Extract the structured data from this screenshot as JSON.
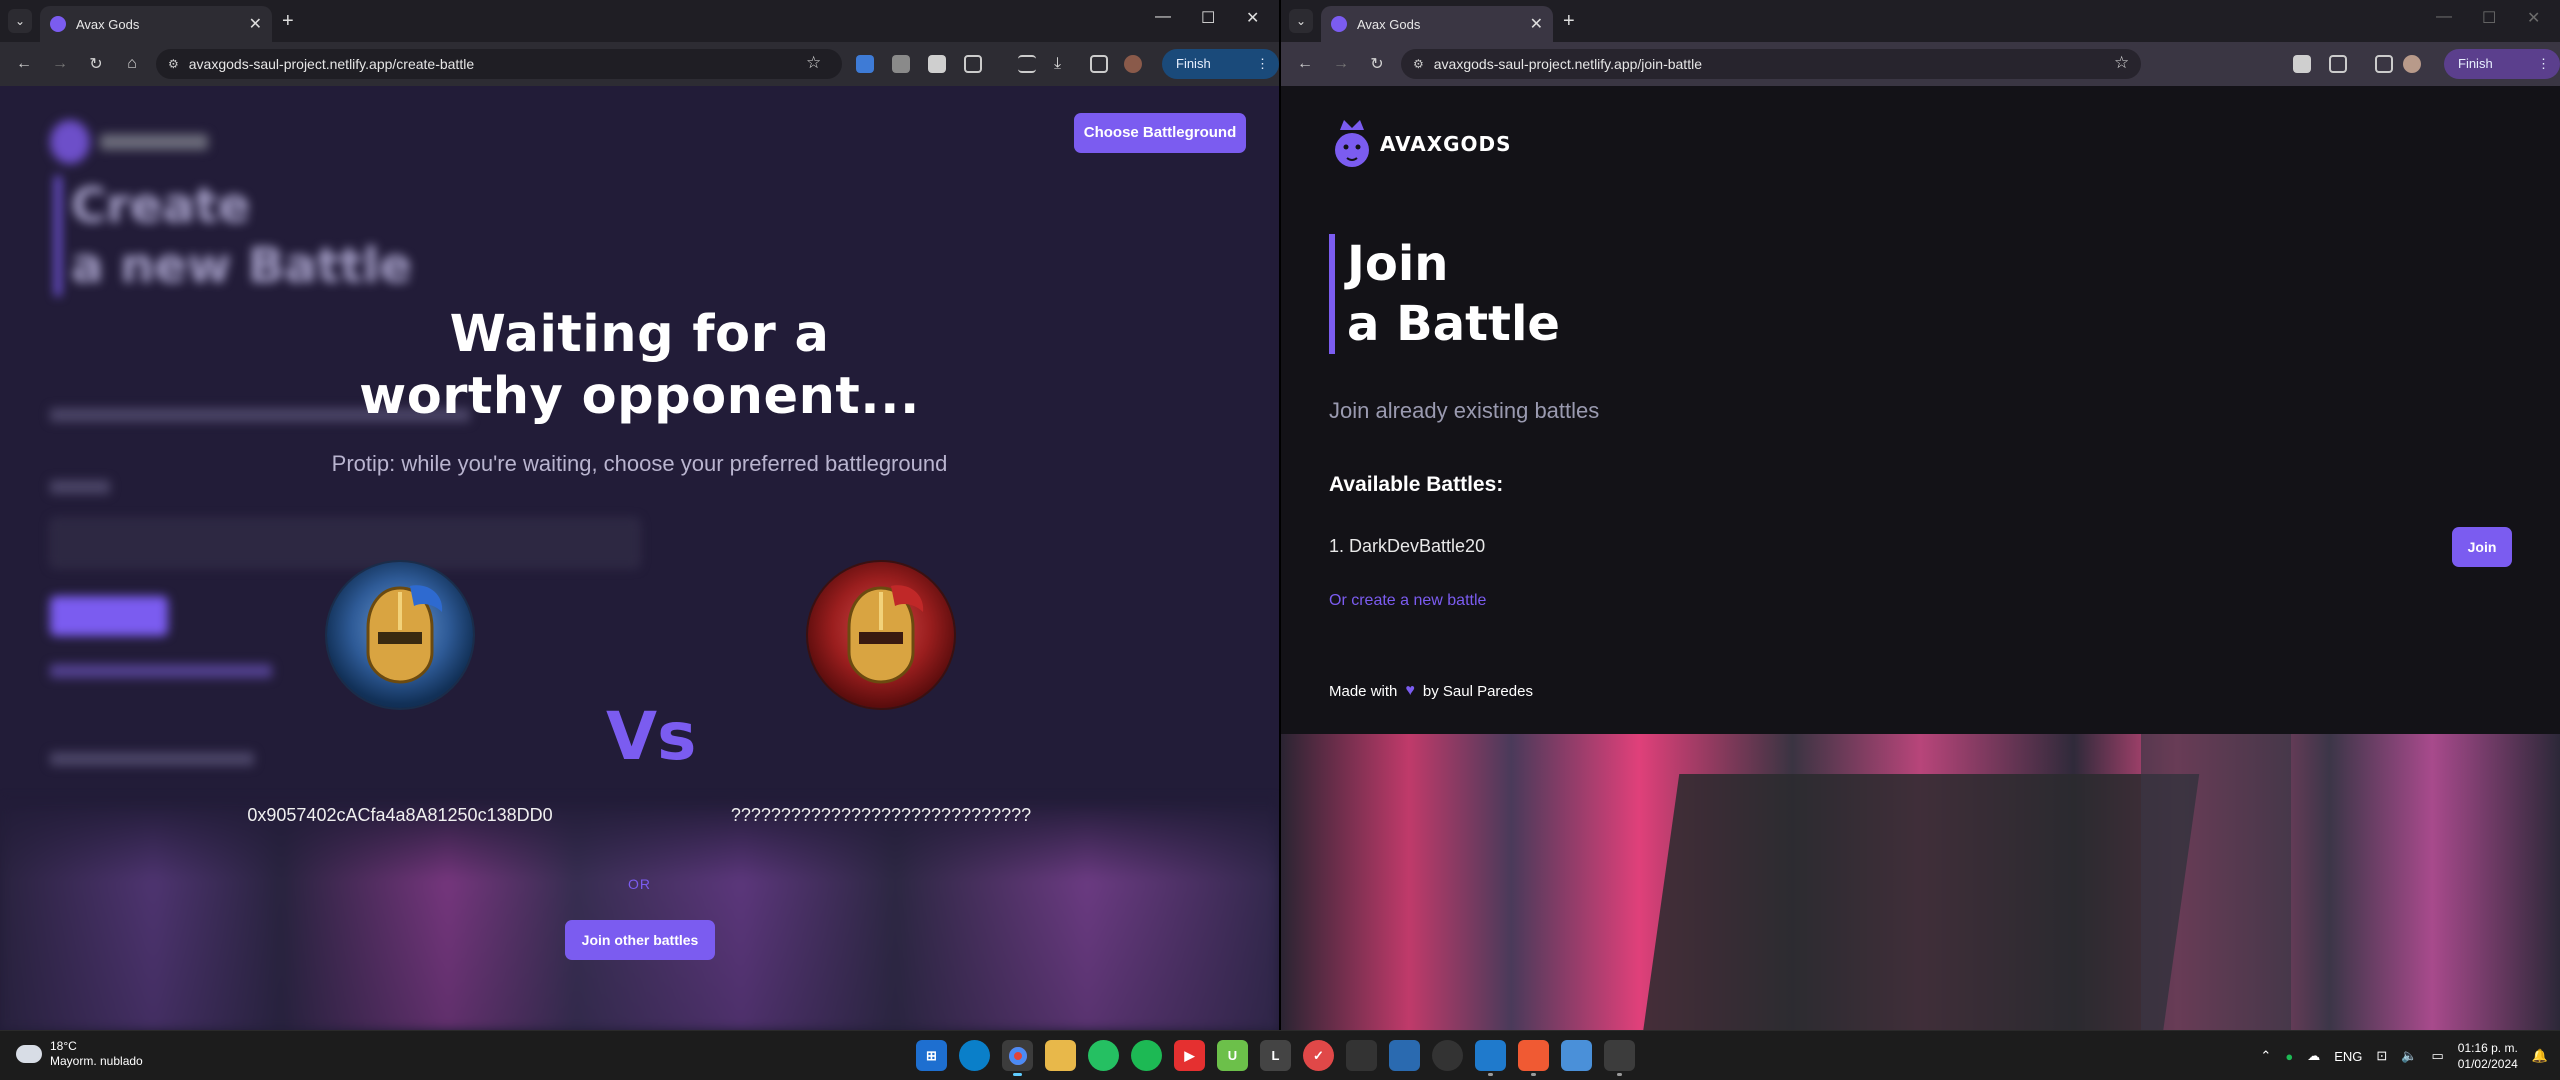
{
  "left_window": {
    "tab_title": "Avax Gods",
    "url": "avaxgods-saul-project.netlify.app/create-battle",
    "finish_update": "Finish update",
    "page": {
      "choose_battleground": "Choose Battleground",
      "wait_title_line1": "Waiting for a",
      "wait_title_line2": "worthy opponent...",
      "protip": "Protip: while you're waiting, choose your preferred battleground",
      "vs": "Vs",
      "player1_address": "0x9057402cACfa4a8A81250c138DD0",
      "player2_address": "??????????????????????????????",
      "or": "OR",
      "join_other": "Join other battles",
      "blurred_title_line1": "Create",
      "blurred_title_line2": "a new Battle"
    }
  },
  "right_window": {
    "tab_title": "Avax Gods",
    "url": "avaxgods-saul-project.netlify.app/join-battle",
    "finish_update": "Finish update",
    "page": {
      "logo_text": "AVAXGODS",
      "title_line1": "Join",
      "title_line2": "a Battle",
      "subtitle": "Join already existing battles",
      "available_label": "Available Battles:",
      "battle_1": "1. DarkDevBattle20",
      "join_label": "Join",
      "create_link": "Or create a new battle",
      "made_with": "Made with",
      "made_by": "by Saul Paredes"
    }
  },
  "taskbar": {
    "weather_temp": "18°C",
    "weather_desc": "Mayorm. nublado",
    "language": "ENG",
    "time": "01:16 p. m.",
    "date": "01/02/2024"
  },
  "colors": {
    "accent": "#7b5cf0",
    "left_bg": "#221c38",
    "right_bg": "#131217"
  }
}
